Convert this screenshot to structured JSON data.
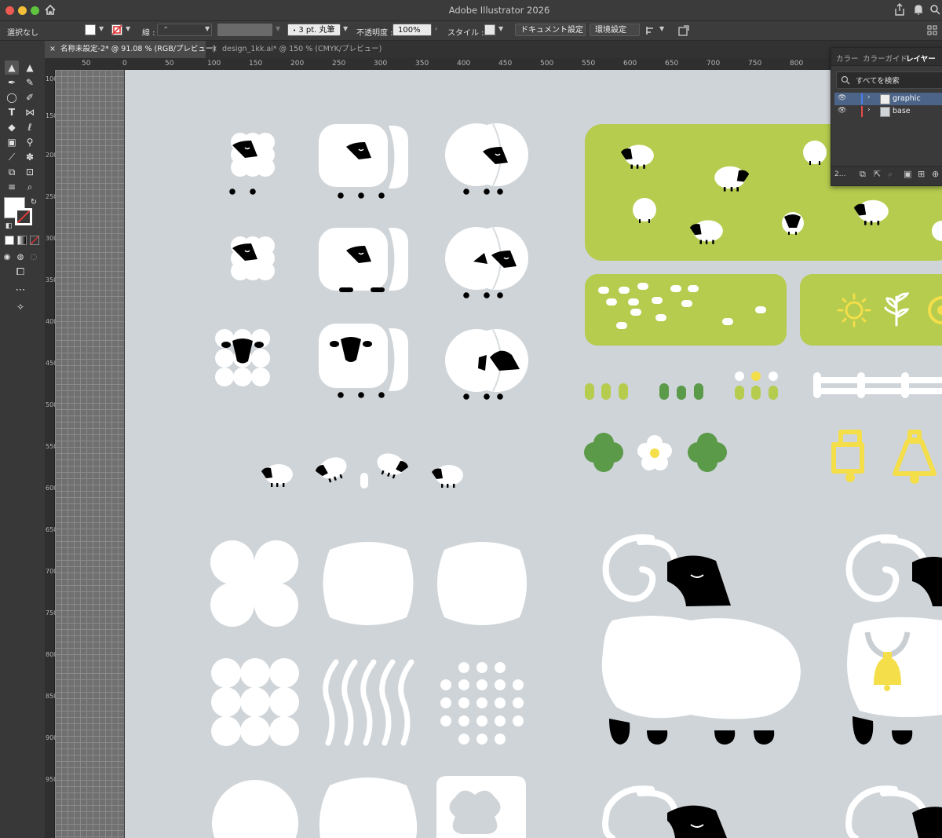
{
  "window": {
    "title": "Adobe Illustrator 2026"
  },
  "control_bar": {
    "selection": "選択なし",
    "stroke_label": "線 :",
    "brush": "3 pt. 丸筆",
    "opacity_label": "不透明度 :",
    "opacity_value": "100%",
    "style_label": "スタイル :",
    "document_settings": "ドキュメント設定",
    "preferences": "環境設定"
  },
  "tabs": [
    {
      "label": "名称未設定-2* @ 91.08 % (RGB/プレビュー)",
      "active": true
    },
    {
      "label": "design_1kk.ai* @ 150 % (CMYK/プレビュー)",
      "active": false
    }
  ],
  "ruler": {
    "h_ticks": [
      "50",
      "0",
      "50",
      "100",
      "150",
      "200",
      "250",
      "300",
      "350",
      "400",
      "450",
      "500",
      "550",
      "600",
      "650",
      "700",
      "750",
      "800"
    ],
    "v_ticks": [
      "100",
      "150",
      "200",
      "250",
      "300",
      "350",
      "400",
      "450",
      "500",
      "550",
      "600",
      "650",
      "700",
      "750",
      "800",
      "850",
      "900",
      "950"
    ]
  },
  "layers_panel": {
    "tabs": [
      "カラー",
      "カラーガイド",
      "レイヤー"
    ],
    "active_tab": "レイヤー",
    "search_placeholder": "すべてを検索",
    "layers": [
      {
        "name": "graphic",
        "color": "#4a7ee8",
        "selected": true
      },
      {
        "name": "base",
        "color": "#e84a4a",
        "selected": false
      }
    ],
    "footer_count": "2..."
  },
  "colors": {
    "accent_green": "#b5cc4e",
    "dark_green": "#5a9a48",
    "yellow": "#f4de4a",
    "artboard": "#cfd4d8"
  }
}
